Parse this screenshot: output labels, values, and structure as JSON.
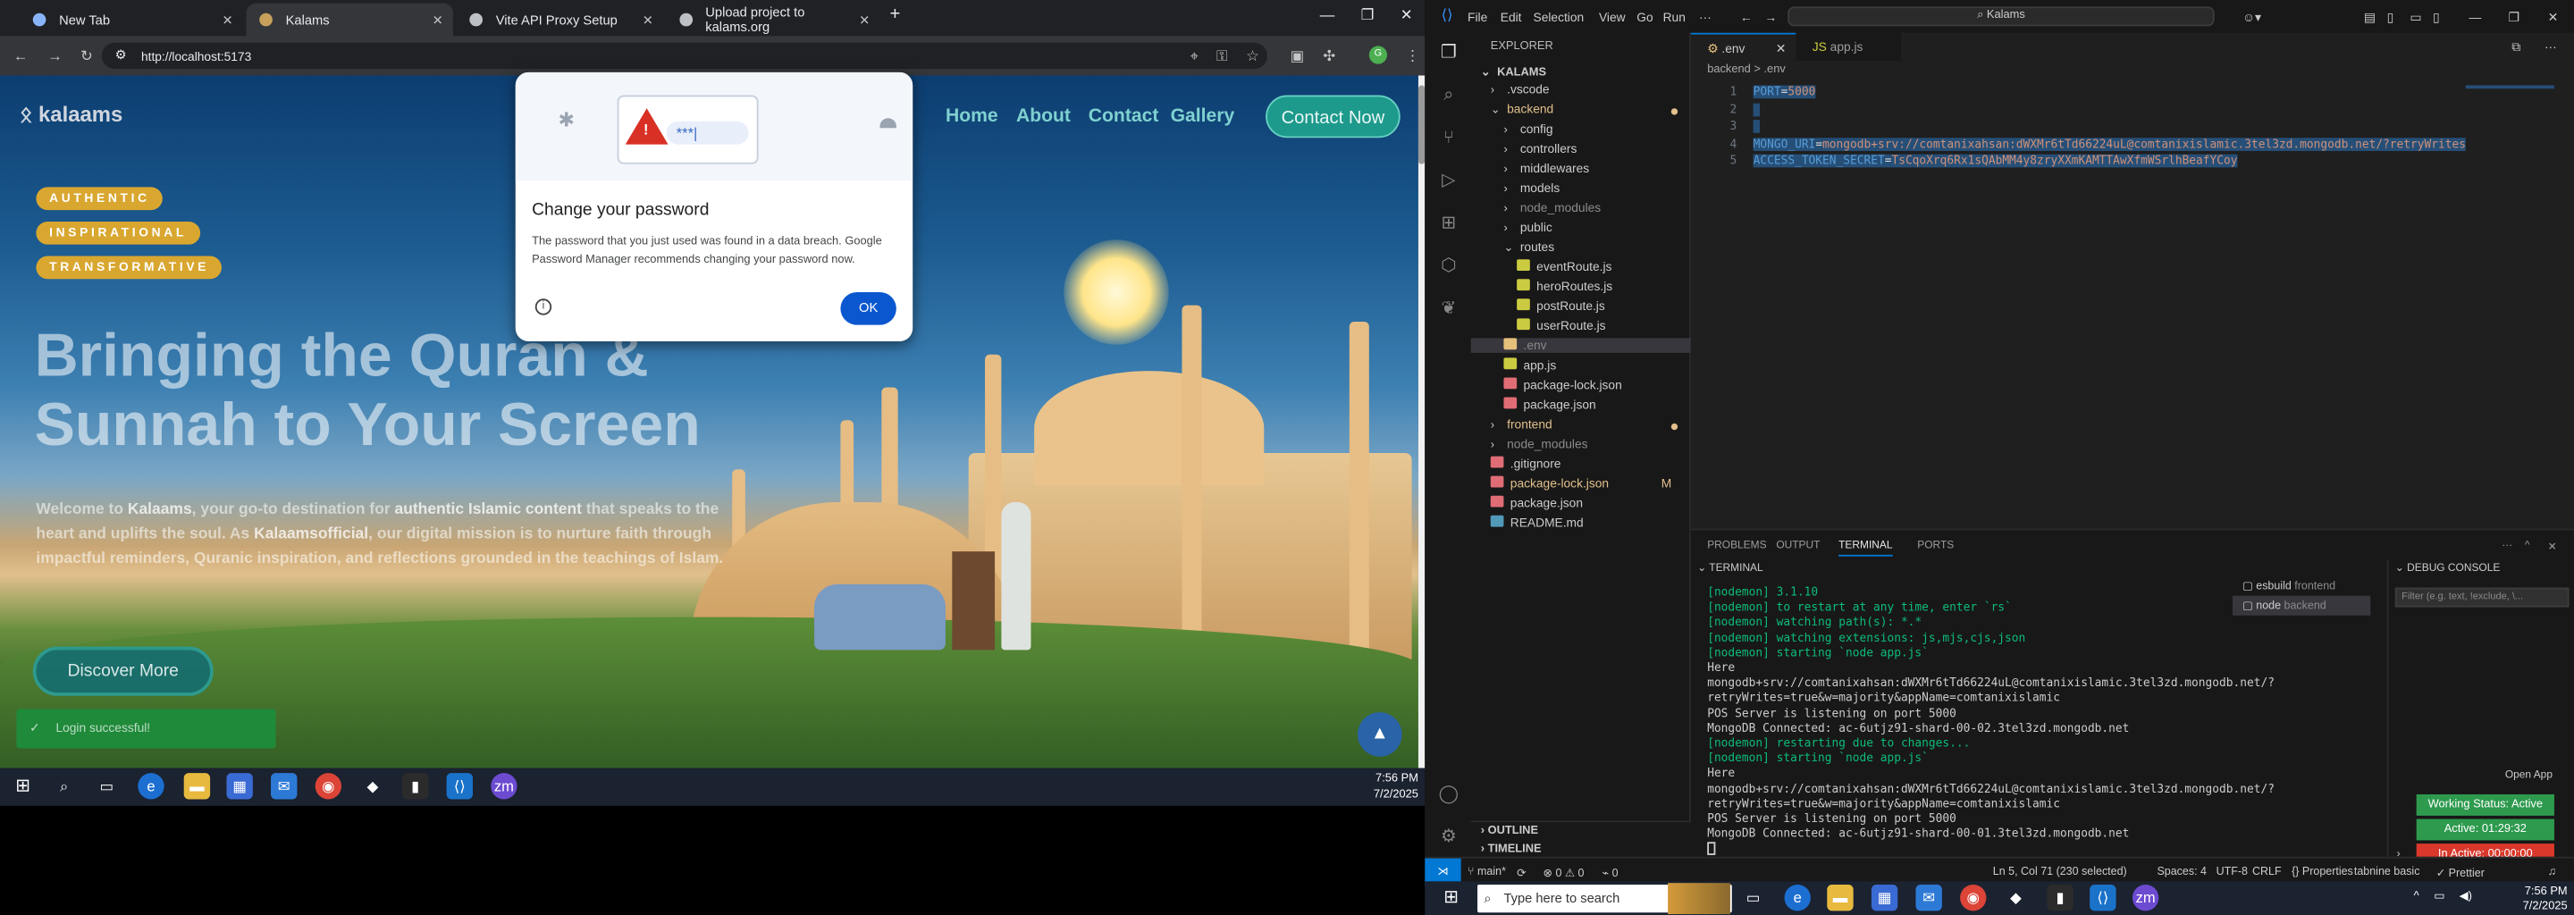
{
  "chrome": {
    "tabs": [
      {
        "title": "New Tab",
        "active": false
      },
      {
        "title": "Kalams",
        "active": true
      },
      {
        "title": "Vite API Proxy Setup",
        "active": false
      },
      {
        "title": "Upload project to kalams.org",
        "active": false
      }
    ],
    "new_tab": "+",
    "url": "http://localhost:5173"
  },
  "site": {
    "logo": "kalaams",
    "nav": [
      "Home",
      "About",
      "Contact",
      "Gallery"
    ],
    "contact_button": "Contact Now",
    "pills": [
      "AUTHENTIC",
      "INSPIRATIONAL",
      "TRANSFORMATIVE"
    ],
    "title": "Bringing the Quran & Sunnah to Your Screen",
    "desc_parts": [
      {
        "t": "Welcome to ",
        "b": false
      },
      {
        "t": "Kalaams",
        "b": true
      },
      {
        "t": ", your go-to destination for ",
        "b": false
      },
      {
        "t": "authentic Islamic content",
        "b": true
      },
      {
        "t": " that speaks to the heart and uplifts the soul. As ",
        "b": false
      },
      {
        "t": "Kalaamsofficial",
        "b": true
      },
      {
        "t": ", our digital mission is to nurture faith through impactful reminders, Quranic inspiration, and reflections grounded in the teachings of Islam.",
        "b": false
      }
    ],
    "discover_button": "Discover More",
    "toast": "Login successful!",
    "to_top": "▲"
  },
  "password_popup": {
    "art_text": "***|",
    "title": "Change your password",
    "body": "The password that you just used was found in a data breach. Google Password Manager recommends changing your password now.",
    "ok": "OK"
  },
  "taskbar_left": {
    "time": "7:56 PM",
    "date": "7/2/2025"
  },
  "vscode": {
    "menu": [
      "File",
      "Edit",
      "Selection",
      "View",
      "Go",
      "Run",
      "···"
    ],
    "search": "Kalams",
    "explorer_title": "EXPLORER",
    "root": "KALAMS",
    "tree": [
      {
        "label": ".vscode",
        "type": "folder",
        "level": 1,
        "open": false
      },
      {
        "label": "backend",
        "type": "folder",
        "level": 1,
        "open": true,
        "dot": true,
        "color": "#e2c08d"
      },
      {
        "label": "config",
        "type": "folder",
        "level": 2,
        "open": false
      },
      {
        "label": "controllers",
        "type": "folder",
        "level": 2,
        "open": false
      },
      {
        "label": "middlewares",
        "type": "folder",
        "level": 2,
        "open": false
      },
      {
        "label": "models",
        "type": "folder",
        "level": 2,
        "open": false
      },
      {
        "label": "node_modules",
        "type": "folder",
        "level": 2,
        "open": false,
        "color": "#8b8b8b"
      },
      {
        "label": "public",
        "type": "folder",
        "level": 2,
        "open": false
      },
      {
        "label": "routes",
        "type": "folder",
        "level": 2,
        "open": true
      },
      {
        "label": "eventRoute.js",
        "type": "file",
        "level": 3,
        "icon": "#cbcb41"
      },
      {
        "label": "heroRoutes.js",
        "type": "file",
        "level": 3,
        "icon": "#cbcb41"
      },
      {
        "label": "postRoute.js",
        "type": "file",
        "level": 3,
        "icon": "#cbcb41"
      },
      {
        "label": "userRoute.js",
        "type": "file",
        "level": 3,
        "icon": "#cbcb41"
      },
      {
        "label": ".env",
        "type": "file",
        "level": 2,
        "icon": "#e5c07b",
        "selected": true,
        "color": "#8b8b8b"
      },
      {
        "label": "app.js",
        "type": "file",
        "level": 2,
        "icon": "#cbcb41"
      },
      {
        "label": "package-lock.json",
        "type": "file",
        "level": 2,
        "icon": "#e06c75"
      },
      {
        "label": "package.json",
        "type": "file",
        "level": 2,
        "icon": "#e06c75"
      },
      {
        "label": "frontend",
        "type": "folder",
        "level": 1,
        "open": false,
        "dot": true,
        "color": "#e2c08d"
      },
      {
        "label": "node_modules",
        "type": "folder",
        "level": 1,
        "open": false,
        "color": "#8b8b8b"
      },
      {
        "label": ".gitignore",
        "type": "file",
        "level": 1,
        "icon": "#e06c75"
      },
      {
        "label": "package-lock.json",
        "type": "file",
        "level": 1,
        "icon": "#e06c75",
        "badge": "M",
        "color": "#e2c08d"
      },
      {
        "label": "package.json",
        "type": "file",
        "level": 1,
        "icon": "#e06c75"
      },
      {
        "label": "README.md",
        "type": "file",
        "level": 1,
        "icon": "#519aba"
      }
    ],
    "editor_tabs": [
      {
        "label": ".env",
        "active": true
      },
      {
        "label": "app.js",
        "active": false
      }
    ],
    "breadcrumb": "backend  >  .env",
    "code": [
      {
        "n": "1",
        "text": "PORT=5000"
      },
      {
        "n": "2",
        "text": ""
      },
      {
        "n": "3",
        "text": ""
      },
      {
        "n": "4",
        "text": "MONGO_URI=mongodb+srv://comtanixahsan:dWXMr6tTd66224uL@comtanixislamic.3tel3zd.mongodb.net/?retryWrites"
      },
      {
        "n": "5",
        "text": "ACCESS_TOKEN_SECRET=TsCqoXrq6Rx1sQAbMM4y8zryXXmKAMTTAwXfmWSrlhBeafYCoy"
      }
    ],
    "panel_tabs": [
      "PROBLEMS",
      "OUTPUT",
      "TERMINAL",
      "PORTS"
    ],
    "terminal_label": "TERMINAL",
    "terminal_lines": [
      "[nodemon] 3.1.10",
      "[nodemon] to restart at any time, enter `rs`",
      "[nodemon] watching path(s): *.*",
      "[nodemon] watching extensions: js,mjs,cjs,json",
      "[nodemon] starting `node app.js`",
      "Here",
      "mongodb+srv://comtanixahsan:dWXMr6tTd66224uL@comtanixislamic.3tel3zd.mongodb.net/?",
      "retryWrites=true&w=majority&appName=comtanixislamic",
      "POS Server is listening on port 5000",
      "MongoDB Connected: ac-6utjz91-shard-00-02.3tel3zd.mongodb.net",
      "[nodemon] restarting due to changes...",
      "[nodemon] starting `node app.js`",
      "Here",
      "mongodb+srv://comtanixahsan:dWXMr6tTd66224uL@comtanixislamic.3tel3zd.mongodb.net/?",
      "retryWrites=true&w=majority&appName=comtanixislamic",
      "POS Server is listening on port 5000",
      "MongoDB Connected: ac-6utjz91-shard-00-01.3tel3zd.mongodb.net"
    ],
    "terminal_list": [
      {
        "name": "esbuild",
        "sub": "frontend"
      },
      {
        "name": "node",
        "sub": "backend"
      }
    ],
    "debug_console": "DEBUG CONSOLE",
    "filter_placeholder": "Filter (e.g. text, !exclude, \\...",
    "open_app": "Open App",
    "working_status": "Working Status: Active",
    "active_time": "Active: 01:29:32",
    "inactive_time": "In Active: 00:00:00",
    "outline": "OUTLINE",
    "timeline": "TIMELINE",
    "status": {
      "branch": "main*",
      "problems": "⊗ 0 ⚠ 0",
      "ports": "0",
      "cursor": "Ln 5, Col 71 (230 selected)",
      "spaces": "Spaces: 4",
      "enc": "UTF-8",
      "eol": "CRLF",
      "props": "{} Properties",
      "tabnine": "tabnine basic",
      "prettier": "✓ Prettier"
    }
  },
  "taskbar_right": {
    "search": "Type here to search",
    "time": "7:56 PM",
    "date": "7/2/2025"
  }
}
